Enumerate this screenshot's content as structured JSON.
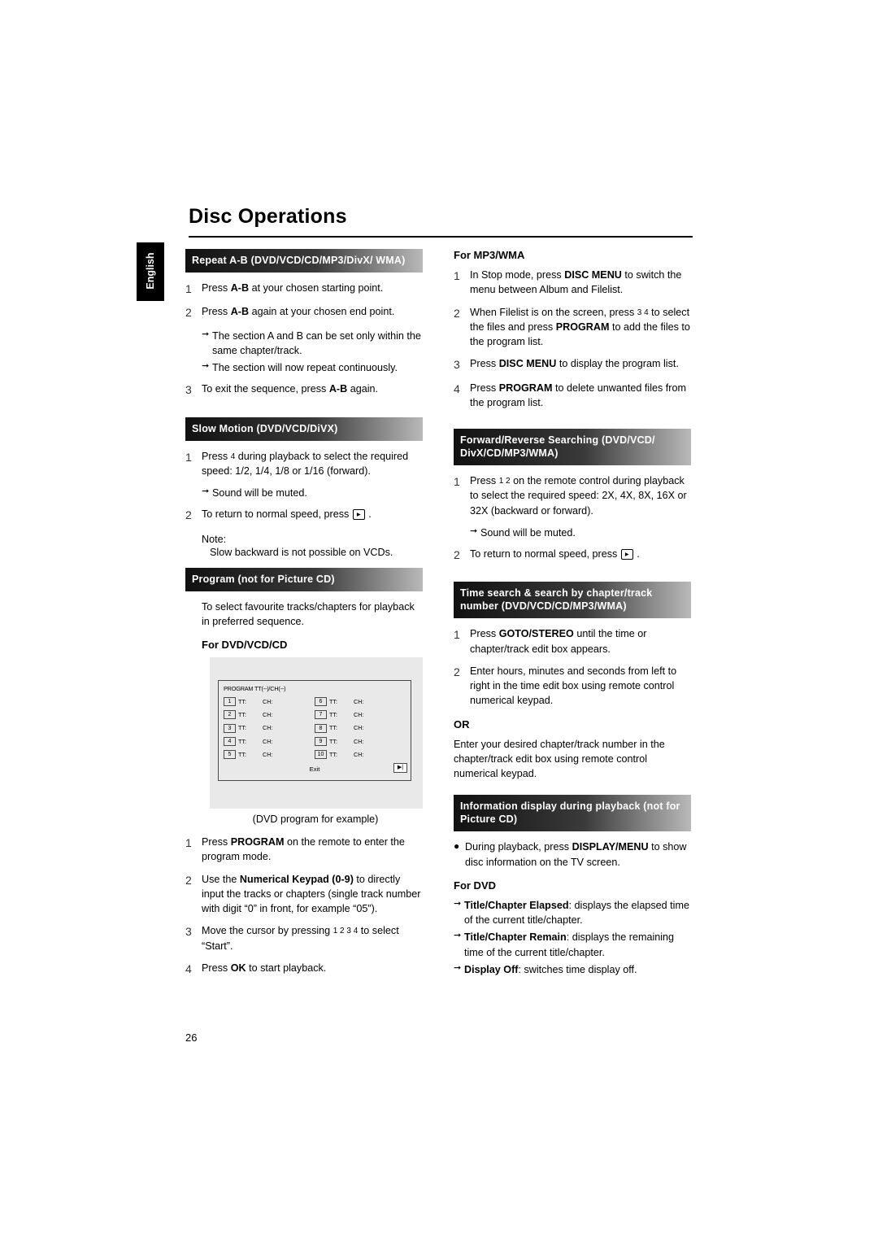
{
  "page": {
    "title": "Disc Operations",
    "language_tab": "English",
    "page_number": "26"
  },
  "left_column": {
    "sections": [
      {
        "heading": "Repeat A-B (DVD/VCD/CD/MP3/DivX/ WMA)",
        "steps": [
          {
            "num": "1",
            "text": "Press A-B at your chosen starting point."
          },
          {
            "num": "2",
            "text": "Press A-B again at your chosen end point."
          }
        ],
        "bullets": [
          "The section A and B can be set only within the same chapter/track.",
          "The section will now repeat continuously."
        ],
        "step3": {
          "num": "3",
          "text": "To exit the sequence, press A-B again."
        }
      },
      {
        "heading": "Slow Motion (DVD/VCD/DiVX)",
        "step1": {
          "num": "1",
          "text": "Press 4 during playback to select the required speed: 1/2, 1/4, 1/8 or 1/16 (forward)."
        },
        "bullet1": "Sound will be muted.",
        "step2": {
          "num": "2",
          "text": "To return to normal speed, press ."
        },
        "note_label": "Note:",
        "note_text": "Slow backward is not possible on VCDs."
      },
      {
        "heading": "Program (not for Picture CD)",
        "intro": "To select favourite tracks/chapters for playback in preferred sequence.",
        "subhead": "For DVD/VCD/CD",
        "illustration": {
          "title": "PROGRAM TT(--)/CH(--)",
          "exit_label": "Exit",
          "next_label": "▶|",
          "rows": [
            {
              "idx_left": "1",
              "tt_left": "TT:",
              "ch_left": "CH:",
              "idx_right": "6",
              "tt_right": "TT:",
              "ch_right": "CH:"
            },
            {
              "idx_left": "2",
              "tt_left": "TT:",
              "ch_left": "CH:",
              "idx_right": "7",
              "tt_right": "TT:",
              "ch_right": "CH:"
            },
            {
              "idx_left": "3",
              "tt_left": "TT:",
              "ch_left": "CH:",
              "idx_right": "8",
              "tt_right": "TT:",
              "ch_right": "CH:"
            },
            {
              "idx_left": "4",
              "tt_left": "TT:",
              "ch_left": "CH:",
              "idx_right": "9",
              "tt_right": "TT:",
              "ch_right": "CH:"
            },
            {
              "idx_left": "5",
              "tt_left": "TT:",
              "ch_left": "CH:",
              "idx_right": "10",
              "tt_right": "TT:",
              "ch_right": "CH:"
            }
          ]
        },
        "caption": "(DVD program for example)",
        "steps": [
          {
            "num": "1",
            "text": "Press PROGRAM on the remote to enter the program mode."
          },
          {
            "num": "2",
            "text": "Use the Numerical Keypad (0-9) to directly input the tracks or chapters (single track number with digit “0” in front, for example “05”)."
          },
          {
            "num": "3",
            "text": "Move the cursor by pressing 1 2 3 4 to select “Start”."
          },
          {
            "num": "4",
            "text": "Press OK to start playback."
          }
        ]
      }
    ]
  },
  "right_column": {
    "sections": [
      {
        "subhead": "For MP3/WMA",
        "steps": [
          {
            "num": "1",
            "text": "In Stop mode, press DISC MENU to switch the menu between Album and Filelist."
          },
          {
            "num": "2",
            "text": "When Filelist is on the screen, press 3 4 to select the files and press PROGRAM to add the files to the program list."
          },
          {
            "num": "3",
            "text": "Press DISC MENU to display the program list."
          },
          {
            "num": "4",
            "text": "Press PROGRAM to delete unwanted files from the program list."
          }
        ]
      },
      {
        "heading": "Forward/Reverse Searching (DVD/VCD/ DivX/CD/MP3/WMA)",
        "step1": {
          "num": "1",
          "text": "Press 1 2 on the remote control during playback to select the required speed: 2X, 4X, 8X, 16X or 32X (backward or forward)."
        },
        "bullet1": "Sound will be muted.",
        "step2": {
          "num": "2",
          "text": "To return to normal speed, press ."
        }
      },
      {
        "heading": "Time search & search by chapter/track number (DVD/VCD/CD/MP3/WMA)",
        "steps": [
          {
            "num": "1",
            "text": "Press GOTO/STEREO until the time or chapter/track edit box appears."
          },
          {
            "num": "2",
            "text": "Enter hours, minutes and seconds from left to right in the time edit box using remote control numerical keypad."
          }
        ],
        "or_label": "OR",
        "or_text": "Enter your desired chapter/track number in the chapter/track edit box using remote control numerical keypad."
      },
      {
        "heading": "Information display during playback (not for Picture CD)",
        "bullet": "During playback, press DISPLAY/MENU to show disc information on the TV screen.",
        "subhead": "For DVD",
        "arrows": [
          {
            "bold": "Title/Chapter Elapsed",
            "rest": ": displays the elapsed time of the current title/chapter."
          },
          {
            "bold": "Title/Chapter Remain",
            "rest": ": displays the remaining time of the current title/chapter."
          },
          {
            "bold": "Display Off",
            "rest": ": switches time display off."
          }
        ]
      }
    ]
  }
}
